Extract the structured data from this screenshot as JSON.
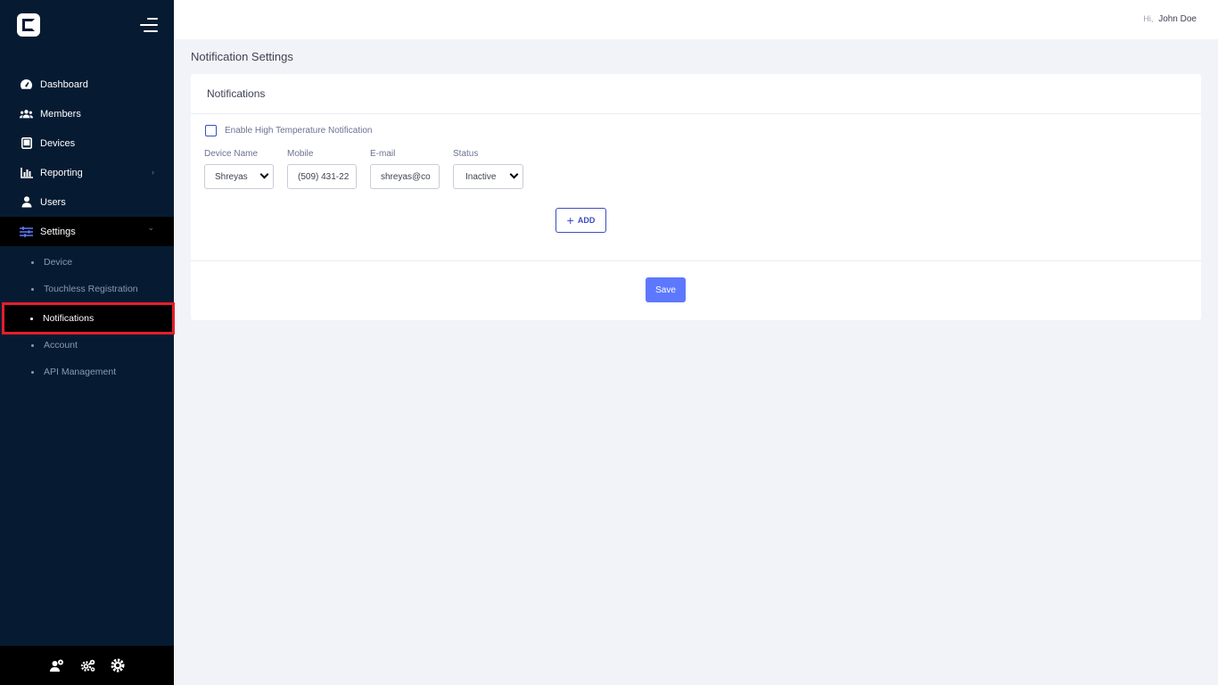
{
  "header": {
    "greeting_prefix": "Hi,",
    "user_name": "John Doe"
  },
  "sidebar": {
    "items": [
      {
        "label": "Dashboard",
        "icon": "dashboard-icon"
      },
      {
        "label": "Members",
        "icon": "users-group-icon"
      },
      {
        "label": "Devices",
        "icon": "tablet-icon"
      },
      {
        "label": "Reporting",
        "icon": "bar-chart-icon",
        "arrow": "›"
      },
      {
        "label": "Users",
        "icon": "user-icon"
      },
      {
        "label": "Settings",
        "icon": "sliders-icon",
        "arrow": "⌄"
      }
    ],
    "settings_subitems": [
      "Device",
      "Touchless Registration",
      "Notifications",
      "Account",
      "API Management"
    ],
    "footer_icons": [
      "user-settings-icon",
      "cogs-icon",
      "gear-icon"
    ]
  },
  "page": {
    "title": "Notification Settings"
  },
  "card": {
    "title": "Notifications",
    "checkbox_label": "Enable High Temperature Notification",
    "fields": {
      "device_name": {
        "label": "Device Name",
        "value": "Shreyas"
      },
      "mobile": {
        "label": "Mobile",
        "value": "(509) 431-22"
      },
      "email": {
        "label": "E-mail",
        "value": "shreyas@co"
      },
      "status": {
        "label": "Status",
        "value": "Inactive"
      }
    },
    "add_label": "ADD",
    "save_label": "Save"
  },
  "colors": {
    "sidebar_bg": "#061b32",
    "accent": "#5d78ff",
    "highlight": "#e61e2a"
  }
}
